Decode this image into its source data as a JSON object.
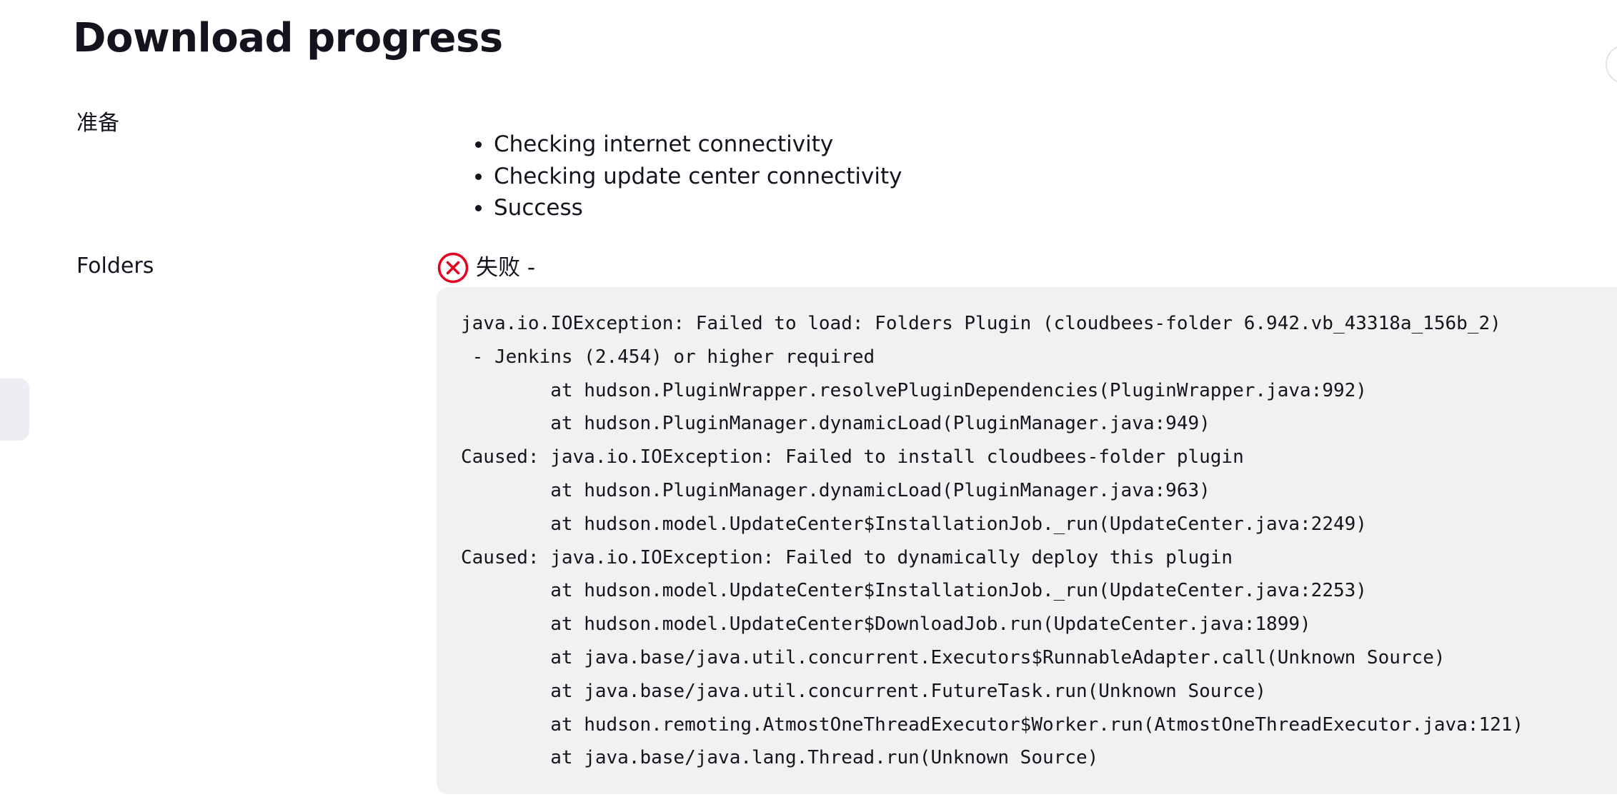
{
  "page": {
    "title": "Download progress"
  },
  "sections": {
    "preparation": {
      "label": "准备",
      "steps": [
        "Checking internet connectivity",
        "Checking update center connectivity",
        "Success"
      ]
    },
    "folders": {
      "label": "Folders",
      "status_icon": "error-circle-x-icon",
      "status_text": "失败 -",
      "status_color": "#e6001f",
      "stacktrace": "java.io.IOException: Failed to load: Folders Plugin (cloudbees-folder 6.942.vb_43318a_156b_2)\n - Jenkins (2.454) or higher required\n\tat hudson.PluginWrapper.resolvePluginDependencies(PluginWrapper.java:992)\n\tat hudson.PluginManager.dynamicLoad(PluginManager.java:949)\nCaused: java.io.IOException: Failed to install cloudbees-folder plugin\n\tat hudson.PluginManager.dynamicLoad(PluginManager.java:963)\n\tat hudson.model.UpdateCenter$InstallationJob._run(UpdateCenter.java:2249)\nCaused: java.io.IOException: Failed to dynamically deploy this plugin\n\tat hudson.model.UpdateCenter$InstallationJob._run(UpdateCenter.java:2253)\n\tat hudson.model.UpdateCenter$DownloadJob.run(UpdateCenter.java:1899)\n\tat java.base/java.util.concurrent.Executors$RunnableAdapter.call(Unknown Source)\n\tat java.base/java.util.concurrent.FutureTask.run(Unknown Source)\n\tat hudson.remoting.AtmostOneThreadExecutor$Worker.run(AtmostOneThreadExecutor.java:121)\n\tat java.base/java.lang.Thread.run(Unknown Source)"
    }
  },
  "colors": {
    "text": "#14141f",
    "code_background": "#f1f1f1",
    "error": "#e6001f"
  }
}
